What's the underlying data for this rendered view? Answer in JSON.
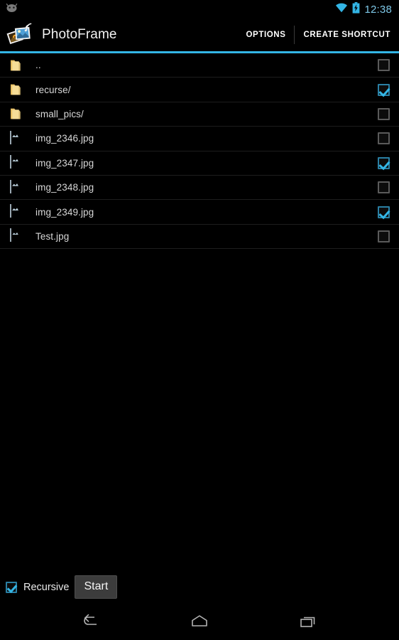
{
  "statusbar": {
    "notification_icon": "android-bugdroid-icon",
    "wifi_icon": "wifi-icon",
    "battery_icon": "battery-charging-icon",
    "time": "12:38",
    "time_color": "#7ec8e8"
  },
  "actionbar": {
    "app_icon": "photoframe-app-icon",
    "title": "PhotoFrame",
    "options_label": "OPTIONS",
    "create_shortcut_label": "CREATE SHORTCUT",
    "accent_color": "#33b5e5"
  },
  "filelist": {
    "rows": [
      {
        "icon": "folder-icon",
        "name": "..",
        "checked": false
      },
      {
        "icon": "folder-icon",
        "name": "recurse/",
        "checked": true
      },
      {
        "icon": "folder-icon",
        "name": "small_pics/",
        "checked": false
      },
      {
        "icon": "image-icon",
        "name": "img_2346.jpg",
        "checked": false
      },
      {
        "icon": "image-icon",
        "name": "img_2347.jpg",
        "checked": true
      },
      {
        "icon": "image-icon",
        "name": "img_2348.jpg",
        "checked": false
      },
      {
        "icon": "image-icon",
        "name": "img_2349.jpg",
        "checked": true
      },
      {
        "icon": "image-icon",
        "name": "Test.jpg",
        "checked": false
      }
    ]
  },
  "bottombar": {
    "recursive_label": "Recursive",
    "recursive_checked": true,
    "start_label": "Start"
  },
  "navbar": {
    "back_icon": "back-arrow-icon",
    "home_icon": "home-icon",
    "recents_icon": "recents-icon"
  }
}
